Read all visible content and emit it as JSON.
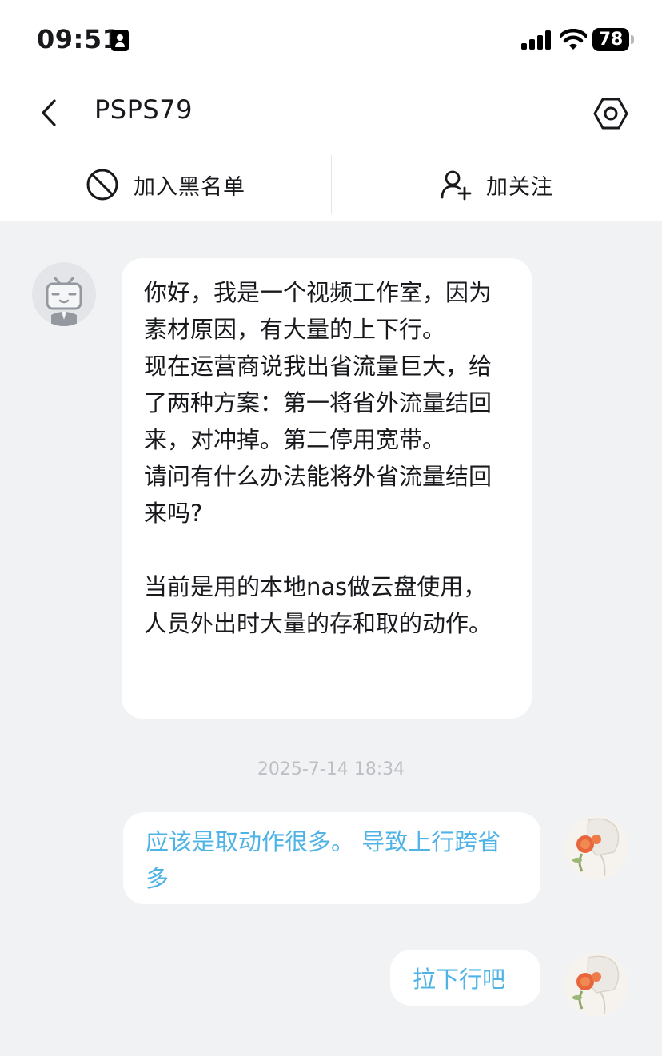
{
  "status_bar": {
    "time": "09:51",
    "battery": "78"
  },
  "header": {
    "title": "PSPS79"
  },
  "actions": {
    "blacklist_label": "加入黑名单",
    "follow_label": "加关注"
  },
  "messages": [
    {
      "direction": "incoming",
      "text": "你好，我是一个视频工作室，因为素材原因，有大量的上下行。\n现在运营商说我出省流量巨大，给了两种方案：第一将省外流量结回来，对冲掉。第二停用宽带。\n请问有什么办法能将外省流量结回来吗?\n\n当前是用的本地nas做云盘使用，人员外出时大量的存和取的动作。"
    },
    {
      "direction": "outgoing",
      "text": "应该是取动作很多。 导致上行跨省多"
    },
    {
      "direction": "outgoing",
      "text": "拉下行吧"
    }
  ],
  "timestamp": "2025-7-14 18:34",
  "colors": {
    "outgoing_text": "#4fb3e6",
    "background": "#f1f2f4",
    "bubble": "#ffffff"
  }
}
